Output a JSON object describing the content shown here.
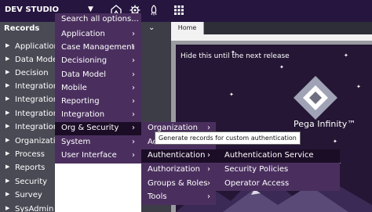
{
  "header": {
    "studio_label": "DEV STUDIO"
  },
  "sidebar": {
    "title": "Records",
    "items": [
      {
        "label": "Application"
      },
      {
        "label": "Data Model"
      },
      {
        "label": "Decision"
      },
      {
        "label": "Integration"
      },
      {
        "label": "Integration"
      },
      {
        "label": "Integration"
      },
      {
        "label": "Integration"
      },
      {
        "label": "Organization"
      },
      {
        "label": "Process"
      },
      {
        "label": "Reports"
      },
      {
        "label": "Security"
      },
      {
        "label": "Survey"
      },
      {
        "label": "SysAdmin"
      }
    ]
  },
  "menu": {
    "search_label": "Search all options...",
    "items": [
      {
        "label": "Application"
      },
      {
        "label": "Case Management"
      },
      {
        "label": "Decisioning"
      },
      {
        "label": "Data Model"
      },
      {
        "label": "Mobile"
      },
      {
        "label": "Reporting"
      },
      {
        "label": "Integration"
      },
      {
        "label": "Org & Security"
      },
      {
        "label": "System"
      },
      {
        "label": "User Interface"
      }
    ]
  },
  "submenu": {
    "items": [
      {
        "label": "Organization"
      },
      {
        "label": "Ac"
      },
      {
        "label": "Authentication"
      },
      {
        "label": "Authorization"
      },
      {
        "label": "Groups & Roles"
      },
      {
        "label": "Tools"
      }
    ]
  },
  "auth_menu": {
    "items": [
      {
        "label": "Authentication Service"
      },
      {
        "label": "Security Policies"
      },
      {
        "label": "Operator Access"
      }
    ]
  },
  "tooltip": {
    "text": "Generate records for custom authentication"
  },
  "tabs": {
    "home": "Home"
  },
  "hero": {
    "notice": "Hide this until the next release",
    "brand": "Pega Infinity™"
  },
  "colors": {
    "topbar": "#25153f",
    "menu": "#4a2f5e",
    "menu_highlight": "#1c0d27",
    "sidebar": "#4a4a55",
    "hero": "#241634"
  }
}
